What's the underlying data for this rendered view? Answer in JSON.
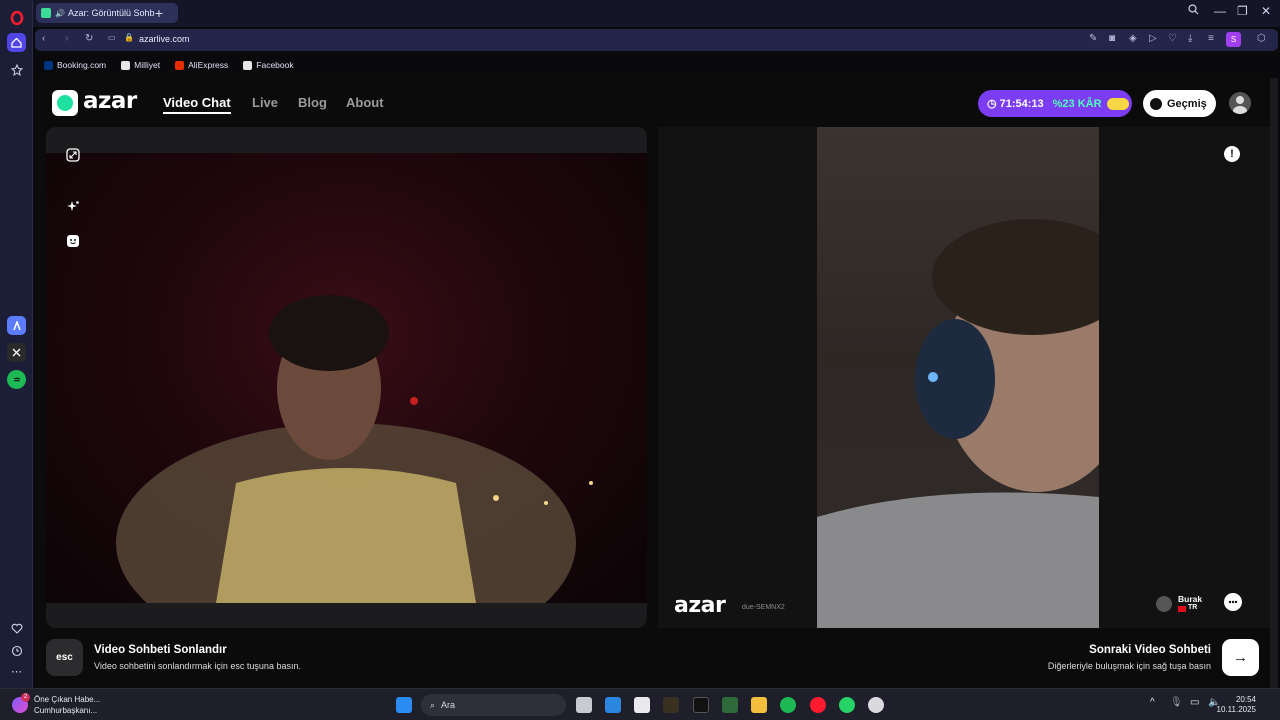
{
  "browser": {
    "tab_title": "Azar: Görüntülü Sohb",
    "url": "azarlive.com",
    "bookmarks": [
      {
        "label": "Booking.com"
      },
      {
        "label": "Milliyet"
      },
      {
        "label": "AliExpress"
      },
      {
        "label": "Facebook"
      }
    ],
    "profile_initial": "S"
  },
  "site": {
    "logo_text": "azar",
    "nav": [
      {
        "label": "Video Chat",
        "active": true
      },
      {
        "label": "Live"
      },
      {
        "label": "Blog"
      },
      {
        "label": "About"
      }
    ],
    "promo": {
      "timer": "71:54:13",
      "offer": "%23 KÂR"
    },
    "history_label": "Geçmiş"
  },
  "video": {
    "watermark": "azar",
    "watermark_id": "due-SEMNX2",
    "peer": {
      "name": "Burak",
      "country": "TR"
    }
  },
  "controls": {
    "esc_key": "esc",
    "end_title": "Video Sohbeti Sonlandır",
    "end_desc": "Video sohbetini sonlandırmak için esc tuşuna basın.",
    "next_title": "Sonraki Video Sohbeti",
    "next_desc": "Diğerleriyle buluşmak için sağ tuşa basın",
    "next_arrow": "→"
  },
  "taskbar": {
    "news_title": "Öne Çıkan Habe...",
    "news_sub": "Cumhurbaşkanı...",
    "news_badge": "2",
    "search_placeholder": "Ara",
    "time": "20:54",
    "date": "10.11.2025"
  },
  "colors": {
    "accent": "#1fe0a1",
    "promo": "#7b3cf2",
    "browser": "#1c1e38"
  }
}
